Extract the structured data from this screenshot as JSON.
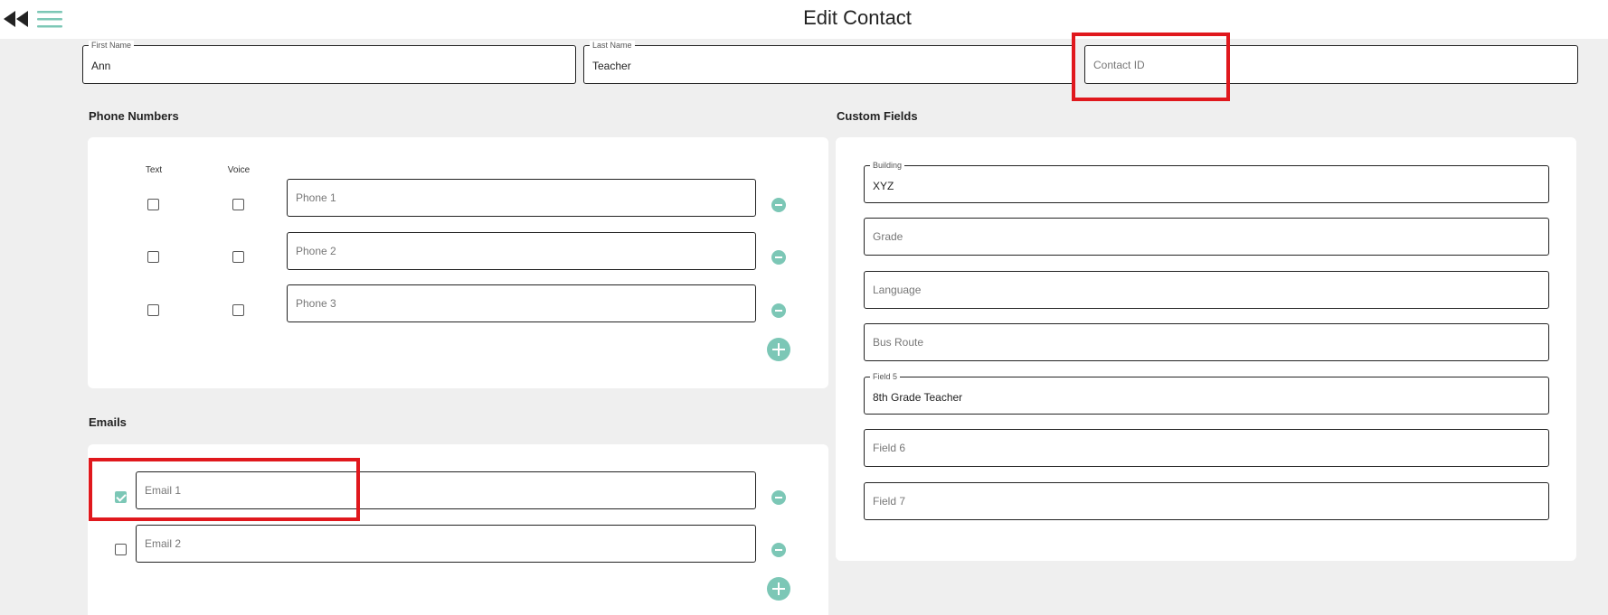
{
  "header": {
    "title": "Edit Contact",
    "back_icon": "rewind-icon",
    "menu_icon": "hamburger-menu-icon"
  },
  "name_fields": {
    "first_name": {
      "label": "First Name",
      "value": "Ann"
    },
    "last_name": {
      "label": "Last Name",
      "value": "Teacher"
    },
    "contact_id": {
      "placeholder": "Contact ID",
      "value": ""
    }
  },
  "phones": {
    "title": "Phone Numbers",
    "col_text": "Text",
    "col_voice": "Voice",
    "items": [
      {
        "placeholder": "Phone 1",
        "text": false,
        "voice": false
      },
      {
        "placeholder": "Phone 2",
        "text": false,
        "voice": false
      },
      {
        "placeholder": "Phone 3",
        "text": false,
        "voice": false
      }
    ]
  },
  "emails": {
    "title": "Emails",
    "items": [
      {
        "placeholder": "Email 1",
        "checked": true
      },
      {
        "placeholder": "Email 2",
        "checked": false
      }
    ]
  },
  "custom_fields": {
    "title": "Custom Fields",
    "items": [
      {
        "label": "Building",
        "value": "XYZ",
        "placeholder": ""
      },
      {
        "label": "",
        "value": "",
        "placeholder": "Grade"
      },
      {
        "label": "",
        "value": "",
        "placeholder": "Language"
      },
      {
        "label": "",
        "value": "",
        "placeholder": "Bus Route"
      },
      {
        "label": "Field 5",
        "value": "8th Grade Teacher",
        "placeholder": ""
      },
      {
        "label": "",
        "value": "",
        "placeholder": "Field 6"
      },
      {
        "label": "",
        "value": "",
        "placeholder": "Field 7"
      }
    ]
  },
  "colors": {
    "accent": "#7cc7b6",
    "highlight": "#e0181d",
    "background": "#efefef"
  }
}
